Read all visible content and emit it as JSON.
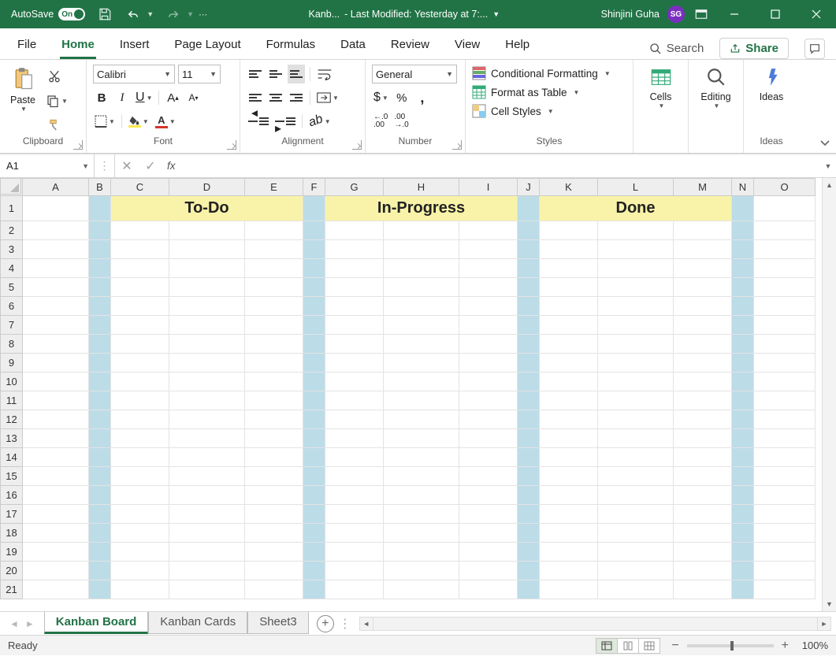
{
  "titlebar": {
    "autosave": "AutoSave",
    "toggle": "On",
    "filename": "Kanb...",
    "modified": "-  Last Modified: Yesterday at 7:...",
    "username": "Shinjini Guha",
    "initials": "SG"
  },
  "menu": {
    "tabs": [
      "File",
      "Home",
      "Insert",
      "Page Layout",
      "Formulas",
      "Data",
      "Review",
      "View",
      "Help"
    ],
    "active": "Home",
    "search": "Search",
    "share": "Share"
  },
  "ribbon": {
    "clipboard": {
      "paste": "Paste",
      "label": "Clipboard"
    },
    "font": {
      "name": "Calibri",
      "size": "11",
      "label": "Font"
    },
    "alignment": {
      "label": "Alignment"
    },
    "number": {
      "format": "General",
      "label": "Number"
    },
    "styles": {
      "cond": "Conditional Formatting",
      "table": "Format as Table",
      "cell": "Cell Styles",
      "label": "Styles"
    },
    "cells": {
      "label": "Cells"
    },
    "editing": {
      "label": "Editing"
    },
    "ideas": {
      "text": "Ideas",
      "label": "Ideas"
    }
  },
  "formula": {
    "namebox": "A1",
    "fx": "fx"
  },
  "grid": {
    "cols": [
      "A",
      "B",
      "C",
      "D",
      "E",
      "F",
      "G",
      "H",
      "I",
      "J",
      "K",
      "L",
      "M",
      "N",
      "O"
    ],
    "rows": [
      "1",
      "2",
      "3",
      "4",
      "5",
      "6",
      "7",
      "8",
      "9",
      "10",
      "11",
      "12",
      "13",
      "14",
      "15",
      "16",
      "17",
      "18",
      "19",
      "20",
      "21"
    ],
    "kanban": {
      "todo": "To-Do",
      "inprogress": "In-Progress",
      "done": "Done"
    },
    "colwidths": {
      "A": 84,
      "B": 28,
      "C": 74,
      "D": 96,
      "E": 74,
      "F": 28,
      "G": 74,
      "H": 96,
      "I": 74,
      "J": 28,
      "K": 74,
      "L": 96,
      "M": 74,
      "N": 28,
      "O": 78
    },
    "row1h": 32
  },
  "sheets": {
    "tabs": [
      "Kanban Board",
      "Kanban Cards",
      "Sheet3"
    ],
    "active": "Kanban Board"
  },
  "status": {
    "ready": "Ready",
    "zoom": "100%"
  }
}
